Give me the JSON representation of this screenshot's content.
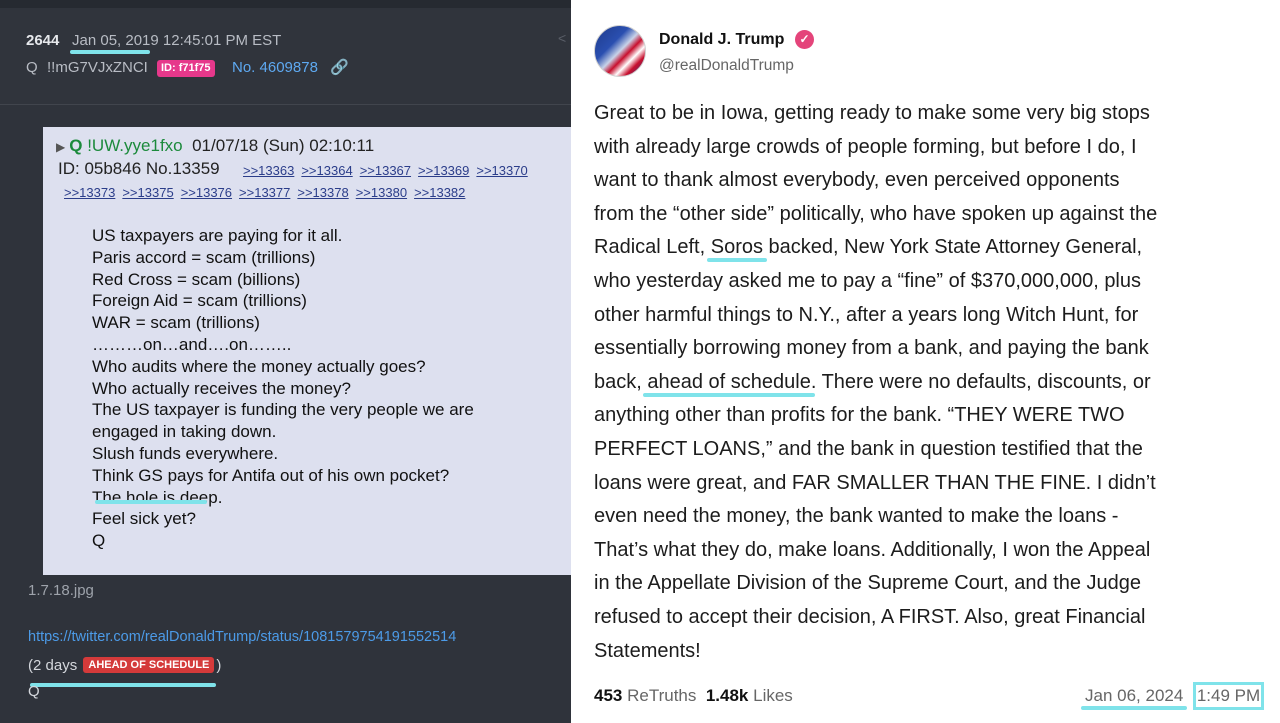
{
  "left": {
    "post_number": "2644",
    "timestamp": "Jan 05, 2019 12:45:01 PM EST",
    "name": "Q",
    "tripcode": "!!mG7VJxZNCI",
    "id_badge": "ID: f71f75",
    "post_no": "No. 4609878",
    "link_icon": "link-icon",
    "quoted": {
      "name": "Q",
      "tripcode": "!UW.yye1fxo",
      "datetime": "01/07/18 (Sun) 02:10:11",
      "id_line": "ID: 05b846 No.13359",
      "refs_line1": [
        ">>13363",
        ">>13364",
        ">>13367",
        ">>13369",
        ">>13370"
      ],
      "refs_line2": [
        ">>13373",
        ">>13375",
        ">>13376",
        ">>13377",
        ">>13378",
        ">>13380",
        ">>13382"
      ],
      "lines": [
        "US taxpayers are paying for it all.",
        "Paris accord = scam (trillions)",
        "Red Cross = scam (billions)",
        "Foreign Aid = scam (trillions)",
        "WAR = scam (trillions)",
        "………on…and….on……..",
        "Who audits where the money actually goes?",
        "Who actually receives the money?",
        "The US taxpayer is funding the very people we are",
        "engaged in taking down.",
        "Slush funds everywhere.",
        "Think GS pays for Antifa out of his own pocket?",
        "The hole is deep.",
        "Feel sick yet?",
        "Q"
      ]
    },
    "filename": "1.7.18.jpg",
    "twitter_url": "https://twitter.com/realDonaldTrump/status/1081579754191552514",
    "days_prefix": "(2 days",
    "ahead_badge": "AHEAD OF SCHEDULE",
    "days_suffix": ")",
    "signature": "Q"
  },
  "right": {
    "display_name": "Donald J. Trump",
    "handle": "@realDonaldTrump",
    "post_lines": [
      "Great to be in Iowa, getting ready to make some very big stops",
      "with already large crowds of people forming, but before I do, I",
      "want to thank almost everybody, even perceived opponents",
      "from the “other side” politically, who have spoken up against the",
      "Radical Left, Soros backed, New York State Attorney General,",
      "who yesterday asked me to pay a “fine” of $370,000,000, plus",
      "other harmful things to N.Y., after a years long Witch Hunt, for",
      "essentially borrowing money from a bank, and paying the bank",
      "back, ahead of schedule. There were no defaults, discounts, or",
      "anything other than profits for the bank. “THEY WERE TWO",
      "PERFECT LOANS,” and the bank in question testified that the",
      "loans were great, and FAR SMALLER THAN THE FINE. I didn’t",
      "even need the money, the bank wanted to make the loans -",
      "That’s what they do, make loans. Additionally, I won the Appeal",
      "in the Appellate Division of the Supreme Court, and the Judge",
      "refused to accept their decision, A FIRST. Also, great Financial",
      "Statements!"
    ],
    "highlight_phrases": [
      "Soros",
      "ahead of schedule"
    ],
    "retruths_count": "453",
    "retruths_label": "ReTruths",
    "likes_count": "1.48k",
    "likes_label": "Likes",
    "date": "Jan 06, 2024",
    "time": "1:49 PM",
    "accent_color": "#7fe3ea"
  }
}
